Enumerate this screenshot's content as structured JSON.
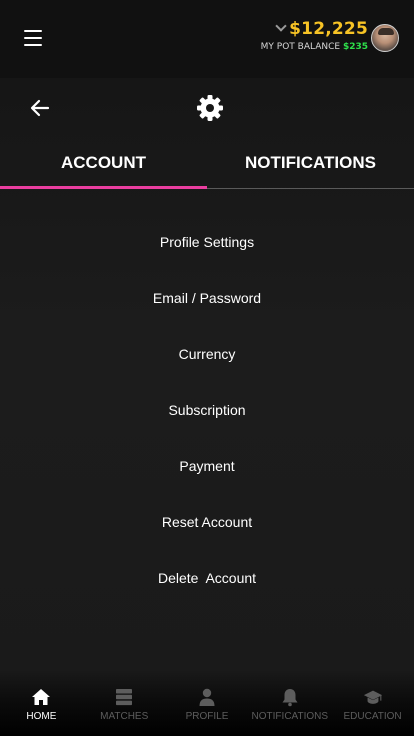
{
  "header": {
    "balance": "$12,225",
    "pot_label": "MY POT BALANCE",
    "pot_amount": "$235",
    "colors": {
      "balance": "#f7c325",
      "pot": "#2ee04b"
    }
  },
  "icons": {
    "menu": "hamburger-icon",
    "back": "arrow-left-icon",
    "settings": "gear-icon",
    "dropdown": "chevron-down-icon"
  },
  "tabs": [
    {
      "label": "ACCOUNT",
      "active": true
    },
    {
      "label": "NOTIFICATIONS",
      "active": false
    }
  ],
  "accent_color": "#ea3e9f",
  "menu_items": [
    {
      "label": "Profile Settings"
    },
    {
      "label": "Email / Password"
    },
    {
      "label": "Currency"
    },
    {
      "label": "Subscription"
    },
    {
      "label": "Payment"
    },
    {
      "label": "Reset Account"
    },
    {
      "label": "Delete  Account"
    }
  ],
  "bottom_nav": [
    {
      "label": "HOME",
      "icon": "home-icon",
      "active": true
    },
    {
      "label": "MATCHES",
      "icon": "list-icon",
      "active": false
    },
    {
      "label": "PROFILE",
      "icon": "user-icon",
      "active": false
    },
    {
      "label": "NOTIFICATIONS",
      "icon": "bell-icon",
      "active": false
    },
    {
      "label": "EDUCATION",
      "icon": "graduation-cap-icon",
      "active": false
    }
  ]
}
